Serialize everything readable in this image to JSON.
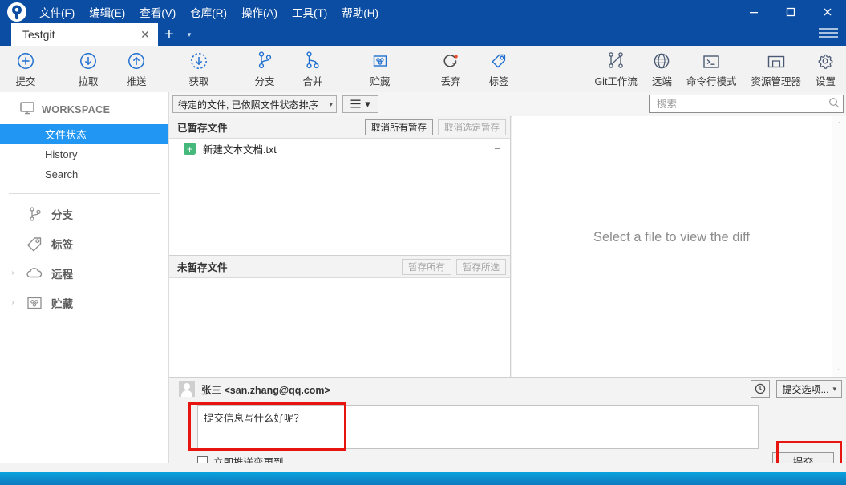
{
  "window": {
    "app_logo": "sourcetree-logo-icon",
    "minimize": "−",
    "maximize": "□",
    "close": "✕",
    "menu": [
      "文件(F)",
      "编辑(E)",
      "查看(V)",
      "仓库(R)",
      "操作(A)",
      "工具(T)",
      "帮助(H)"
    ],
    "title_bar_color": "#0b4da2"
  },
  "tabs": {
    "active_tab": "Testgit",
    "close_glyph": "✕",
    "add_glyph": "+",
    "dropdown_glyph": "▾"
  },
  "toolbar": {
    "left_items": [
      {
        "label": "提交",
        "icon": "commit-plus-circle-icon"
      },
      {
        "label": "拉取",
        "icon": "pull-down-arrow-icon"
      },
      {
        "label": "推送",
        "icon": "push-up-arrow-icon"
      },
      {
        "label": "获取",
        "icon": "fetch-dashed-arrow-icon"
      },
      {
        "label": "分支",
        "icon": "branch-icon"
      },
      {
        "label": "合并",
        "icon": "merge-icon"
      },
      {
        "label": "贮藏",
        "icon": "stash-box-icon"
      },
      {
        "label": "丢弃",
        "icon": "discard-refresh-icon"
      },
      {
        "label": "标签",
        "icon": "tag-icon"
      }
    ],
    "right_items": [
      {
        "label": "Git工作流",
        "icon": "gitflow-icon"
      },
      {
        "label": "远端",
        "icon": "globe-remote-icon"
      },
      {
        "label": "命令行模式",
        "icon": "terminal-icon"
      },
      {
        "label": "资源管理器",
        "icon": "folder-explorer-icon"
      },
      {
        "label": "设置",
        "icon": "gear-settings-icon"
      }
    ]
  },
  "filterbar": {
    "sort_combo_value": "待定的文件, 已依照文件状态排序",
    "sort_combo_caret": "▾",
    "view_mode_icon": "list-view-icon",
    "view_mode_caret": "▾",
    "search_placeholder": "搜索",
    "search_value": "",
    "search_icon": "search-icon"
  },
  "sidebar": {
    "workspace": {
      "label": "WORKSPACE",
      "icon": "monitor-icon"
    },
    "workspace_children": [
      {
        "label": "文件状态",
        "active": true
      },
      {
        "label": "History",
        "active": false
      },
      {
        "label": "Search",
        "active": false
      }
    ],
    "sections": [
      {
        "label": "分支",
        "icon": "branch-icon",
        "chevron": ""
      },
      {
        "label": "标签",
        "icon": "tag-icon",
        "chevron": ""
      },
      {
        "label": "远程",
        "icon": "cloud-icon",
        "chevron": "›"
      },
      {
        "label": "贮藏",
        "icon": "stash-box-icon",
        "chevron": "›"
      }
    ],
    "active_color": "#2196f3"
  },
  "staged": {
    "title": "已暂存文件",
    "unstage_all_label": "取消所有暂存",
    "unstage_selected_label": "取消选定暂存",
    "unstage_selected_disabled": true,
    "files": [
      {
        "name": "新建文本文档.txt",
        "status_glyph": "+",
        "status_color": "#45b97c",
        "action_glyph": "−"
      }
    ]
  },
  "unstaged": {
    "title": "未暂存文件",
    "stage_all_label": "暂存所有",
    "stage_selected_label": "暂存所选",
    "stage_all_disabled": true,
    "stage_selected_disabled": true,
    "files": []
  },
  "diff": {
    "empty_message": "Select a file to view the diff",
    "scroll_up_glyph": "⌃",
    "scroll_down_glyph": "⌄"
  },
  "commit": {
    "author": "张三 <san.zhang@qq.com>",
    "avatar_icon": "user-avatar-icon",
    "history_button_icon": "clock-history-icon",
    "options_label": "提交选项...",
    "options_caret": "▾",
    "message_value": "提交信息写什么好呢？",
    "push_checkbox_label": "立即推送变更到 -",
    "push_checked": false,
    "commit_button_label": "提交"
  },
  "annotations": {
    "color": "#e8140f",
    "boxes": [
      "commit-message-box",
      "commit-button"
    ]
  }
}
